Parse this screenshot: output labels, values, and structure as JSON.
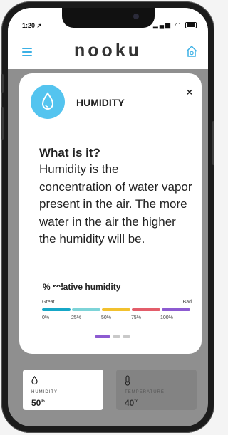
{
  "status_bar": {
    "time": "1:20 ➚"
  },
  "header": {
    "brand": "nooku"
  },
  "popup": {
    "title": "HUMIDITY",
    "close_label": "×",
    "question": "What is it?",
    "description": "Humidity is the concentration of water vapor present in the air. The more water in the air the higher the humidity will be.",
    "scale_title": "% relative humidity",
    "scale_low_label": "Great",
    "scale_high_label": "Bad",
    "ticks": [
      "0%",
      "25%",
      "50%",
      "75%",
      "100%"
    ],
    "colors": [
      "#16a7c7",
      "#7dd4d8",
      "#f2c12e",
      "#e35d6a",
      "#8d5bd1"
    ],
    "pager": {
      "pages": 3,
      "active": 0
    }
  },
  "tiles": [
    {
      "label": "HUMIDITY",
      "value": "50",
      "unit": "%",
      "selected": true
    },
    {
      "label": "TEMPERATURE",
      "value": "40",
      "unit": "°c",
      "selected": false
    }
  ],
  "accent_color": "#3bb0e5",
  "icons": [
    "menu-icon",
    "home-settings-icon",
    "water-drop-icon",
    "thermometer-icon"
  ]
}
